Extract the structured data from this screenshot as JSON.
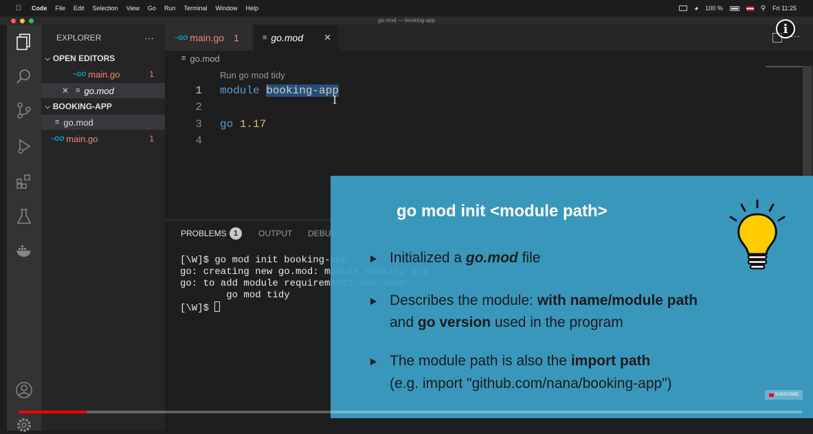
{
  "menubar": {
    "app": "Code",
    "items": [
      "File",
      "Edit",
      "Selection",
      "View",
      "Go",
      "Run",
      "Terminal",
      "Window",
      "Help"
    ],
    "battery": "100 %",
    "clock": "Fri 11:25"
  },
  "window_title": "go.mod — booking-app",
  "sidebar": {
    "title": "EXPLORER",
    "more": "···",
    "open_editors_label": "OPEN EDITORS",
    "open_editors": [
      {
        "name": "main.go",
        "badge": "1"
      },
      {
        "name": "go.mod"
      }
    ],
    "project_label": "BOOKING-APP",
    "files": [
      {
        "name": "go.mod"
      },
      {
        "name": "main.go",
        "badge": "1"
      }
    ]
  },
  "tabs": [
    {
      "label": "main.go",
      "badge": "1"
    },
    {
      "label": "go.mod",
      "close": "✕"
    }
  ],
  "breadcrumb": "go.mod",
  "editor": {
    "codelens": "Run go mod tidy",
    "line_numbers": [
      "1",
      "2",
      "3",
      "4"
    ],
    "line1_kw": "module",
    "line1_name": "booking-app",
    "line3_kw": "go",
    "line3_ver": "1.17"
  },
  "panel": {
    "tabs": {
      "problems": "PROBLEMS",
      "problems_count": "1",
      "output": "OUTPUT",
      "debug": "DEBUG"
    },
    "terminal": [
      "[\\W]$ go mod init booking-app",
      "go: creating new go.mod: module booking-app",
      "go: to add module requirements and sums:",
      "        go mod tidy",
      "[\\W]$ "
    ]
  },
  "slide": {
    "title": "go mod init <module path>",
    "b1_pre": "Initialized a ",
    "b1_em": "go.mod",
    "b1_post": " file",
    "b2_l1_pre": "Describes the module: ",
    "b2_l1_bold": "with name/module path",
    "b2_l2_pre": "and ",
    "b2_l2_bold": "go version",
    "b2_l2_post": " used in the program",
    "b3_l1_pre": "The module path is also the ",
    "b3_l1_bold": "import path",
    "b3_l2": "(e.g. import \"github.com/nana/booking-app\")"
  },
  "video": {
    "progress_fraction": 0.087,
    "subscribe": "SUBSCRIBE",
    "info": "i"
  }
}
